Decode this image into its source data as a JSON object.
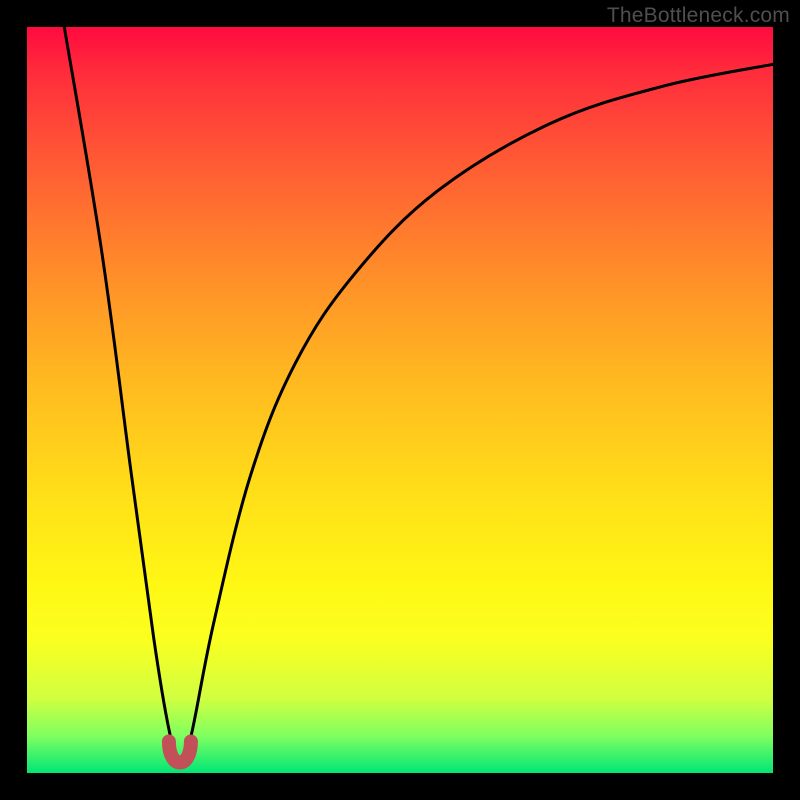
{
  "watermark": "TheBottleneck.com",
  "chart_data": {
    "type": "line",
    "title": "",
    "xlabel": "",
    "ylabel": "",
    "xlim": [
      0,
      100
    ],
    "ylim": [
      0,
      100
    ],
    "series": [
      {
        "name": "bottleneck-curve",
        "x": [
          5,
          10,
          14,
          17,
          19,
          20.5,
          22,
          25,
          30,
          36,
          44,
          55,
          70,
          85,
          100
        ],
        "values": [
          100,
          70,
          40,
          18,
          6,
          1,
          5,
          20,
          40,
          55,
          67,
          78,
          87,
          92,
          95
        ]
      }
    ],
    "annotations": [
      {
        "name": "minimum-marker",
        "x": 20.5,
        "y": 1
      }
    ],
    "colors": {
      "gradient_top": "#ff0a3e",
      "gradient_bottom": "#00e676",
      "curve": "#000000",
      "min_marker": "#c15058",
      "frame": "#000000"
    }
  }
}
